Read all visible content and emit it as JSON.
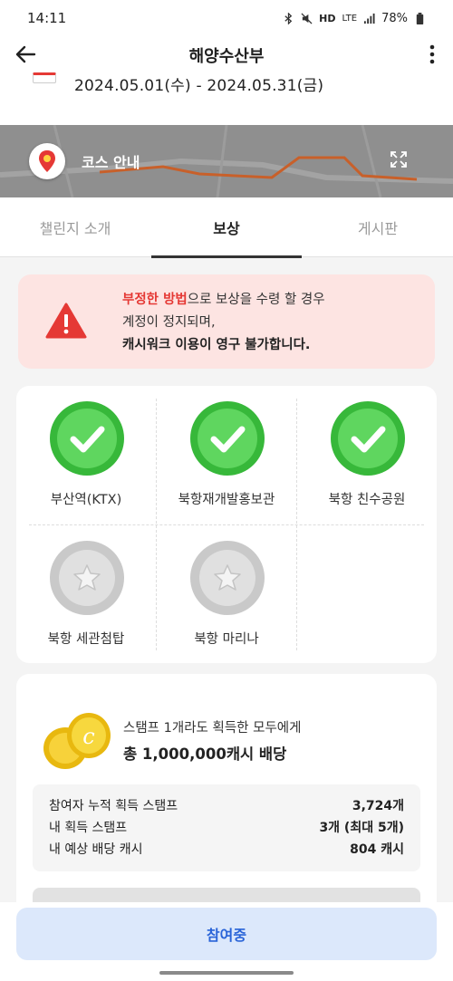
{
  "status": {
    "time": "14:11",
    "network": "HD",
    "lte": "LTE",
    "battery": "78%"
  },
  "header": {
    "title": "해양수산부"
  },
  "challenge": {
    "period": "2024.05.01(수) - 2024.05.31(금)"
  },
  "map": {
    "label": "코스 안내"
  },
  "tabs": [
    {
      "label": "챌린지 소개",
      "active": false
    },
    {
      "label": "보상",
      "active": true
    },
    {
      "label": "게시판",
      "active": false
    }
  ],
  "warning": {
    "highlight": "부정한 방법",
    "line1_rest": "으로 보상을 수령 할 경우",
    "line2": "계정이 정지되며,",
    "line3": "캐시워크 이용이 영구 불가합니다."
  },
  "stamps": [
    {
      "label": "부산역(KTX)",
      "acquired": true
    },
    {
      "label": "북항재개발홍보관",
      "acquired": true
    },
    {
      "label": "북항 친수공원",
      "acquired": true
    },
    {
      "label": "북항 세관첨탑",
      "acquired": false
    },
    {
      "label": "북항 마리나",
      "acquired": false
    }
  ],
  "reward": {
    "line1": "스탬프 1개라도 획득한 모두에게",
    "line2": "총 1,000,000캐시 배당",
    "stats": [
      {
        "label": "참여자 누적 획득 스탬프",
        "value": "3,724개"
      },
      {
        "label": "내 획득 스탬프",
        "value": "3개 (최대 5개)"
      },
      {
        "label": "내 예상 배당 캐시",
        "value": "804 캐시"
      }
    ]
  },
  "cta": {
    "label": "참여중"
  },
  "colors": {
    "accent_red": "#e53935",
    "success_green": "#3cc03c",
    "cta_blue": "#2a64d8",
    "cta_bg": "#dce8fb"
  }
}
